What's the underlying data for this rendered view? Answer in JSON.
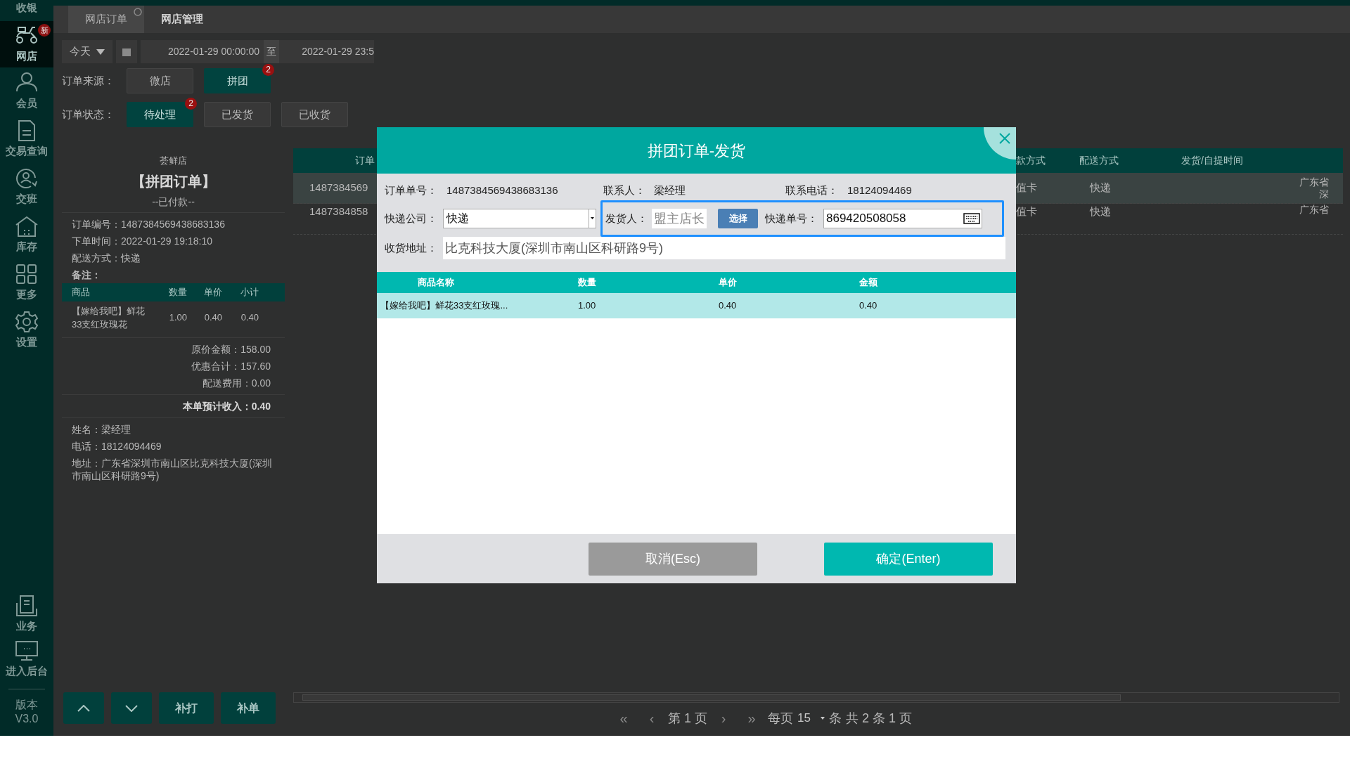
{
  "sidebar": {
    "items": [
      {
        "label": "收银",
        "kind": "none",
        "selected": false
      },
      {
        "label": "网店",
        "kind": "scooter",
        "selected": true,
        "badge": "新"
      },
      {
        "label": "会员",
        "kind": "person",
        "selected": false
      },
      {
        "label": "交易查询",
        "kind": "document",
        "selected": false
      },
      {
        "label": "交班",
        "kind": "shift",
        "selected": false
      },
      {
        "label": "库存",
        "kind": "house",
        "selected": false
      },
      {
        "label": "更多",
        "kind": "grid",
        "selected": false
      },
      {
        "label": "设置",
        "kind": "gear",
        "selected": false
      }
    ],
    "bottom_items": [
      {
        "label": "业务",
        "kind": "briefcase",
        "selected": false
      },
      {
        "label": "进入后台",
        "kind": "monitor",
        "selected": false
      }
    ],
    "version": {
      "label": "版本",
      "value": "V3.0"
    }
  },
  "tabs": [
    {
      "label": "网店订单",
      "selected": true
    },
    {
      "label": "网店管理",
      "selected": false
    }
  ],
  "filters": {
    "date_preset": "今天",
    "start": "2022-01-29 00:00:00",
    "separator": "至",
    "end": "2022-01-29 23:5"
  },
  "order_source": {
    "label": "订单来源：",
    "options": [
      {
        "label": "微店",
        "selected": false
      },
      {
        "label": "拼团",
        "selected": true,
        "badge": "2"
      }
    ]
  },
  "order_status": {
    "label": "订单状态：",
    "options": [
      {
        "label": "待处理",
        "selected": true,
        "badge": "2"
      },
      {
        "label": "已发货",
        "selected": false
      },
      {
        "label": "已收货",
        "selected": false
      }
    ]
  },
  "receipt": {
    "store": "荟鲜店",
    "title": "【拼团订单】",
    "status": "--已付款--",
    "fields": [
      {
        "label": "订单编号：",
        "value": "1487384569438683136"
      },
      {
        "label": "下单时间：",
        "value": "2022-01-29 19:18:10"
      },
      {
        "label": "配送方式：",
        "value": "快递"
      }
    ],
    "remark_label": "备注：",
    "columns": [
      "商品",
      "数量",
      "单价",
      "小计"
    ],
    "items": [
      {
        "cells": [
          "【嫁给我吧】鲜花33支红玫瑰花",
          "1.00",
          "0.40",
          "0.40"
        ]
      }
    ],
    "totals": [
      {
        "label": "原价金额：",
        "value": "158.00"
      },
      {
        "label": "优惠合计：",
        "value": "157.60"
      },
      {
        "label": "配送费用：",
        "value": "0.00"
      }
    ],
    "income": {
      "label": "本单预计收入：",
      "value": "0.40"
    },
    "customer": [
      {
        "label": "姓名：",
        "value": "梁经理"
      },
      {
        "label": "电话：",
        "value": "18124094469"
      },
      {
        "label": "地址：",
        "value": "广东省深圳市南山区比克科技大厦(深圳市南山区科研路9号)"
      }
    ]
  },
  "action_buttons": [
    {
      "kind": "up"
    },
    {
      "kind": "down"
    },
    {
      "kind": "text",
      "label": "补打"
    },
    {
      "kind": "text",
      "label": "补单"
    }
  ],
  "orders_table": {
    "columns": [
      "订单",
      "款方式",
      "配送方式",
      "发货/自提时间"
    ],
    "rows": [
      {
        "order": "1487384569",
        "payment": "值卡",
        "delivery": "快递",
        "address": [
          "广东省",
          "深"
        ],
        "selected": true
      },
      {
        "order": "1487384858",
        "payment": "值卡",
        "delivery": "快递",
        "address": [
          "广东省"
        ],
        "selected": false
      }
    ]
  },
  "pagination": {
    "before": [
      {
        "label": "«",
        "disabled": true
      },
      {
        "label": "‹",
        "disabled": true
      }
    ],
    "page_text": "第 1 页",
    "after": [
      {
        "label": "›",
        "disabled": true
      },
      {
        "label": "»",
        "disabled": true
      }
    ],
    "per_page_label": "每页",
    "per_page": "15",
    "unit": "条",
    "summary": "共 2 条 1 页"
  },
  "dialog": {
    "title": "拼团订单-发货",
    "info": [
      {
        "label": "订单单号：",
        "value": "1487384569438683136"
      },
      {
        "label": "联系人：",
        "value": "梁经理"
      },
      {
        "label": "联系电话：",
        "value": "18124094469"
      }
    ],
    "courier": {
      "label": "快递公司：",
      "value": "快递"
    },
    "dispatch_group": {
      "focused": true,
      "shipper": {
        "label": "发货人：",
        "placeholder": "盟主店长"
      },
      "choose_button": "选择",
      "tracking": {
        "label": "快递单号：",
        "value": "869420508058"
      }
    },
    "address": {
      "label": "收货地址：",
      "value": "比克科技大厦(深圳市南山区科研路9号)"
    },
    "items": {
      "columns": [
        "商品名称",
        "数量",
        "单价",
        "金额"
      ],
      "rows": [
        {
          "cells": [
            "【嫁给我吧】鲜花33支红玫瑰...",
            "1.00",
            "0.40",
            "0.40"
          ],
          "selected": true
        }
      ]
    },
    "buttons": [
      {
        "kind": "cancel",
        "label": "取消(Esc)"
      },
      {
        "kind": "confirm",
        "label": "确定(Enter)"
      }
    ]
  }
}
